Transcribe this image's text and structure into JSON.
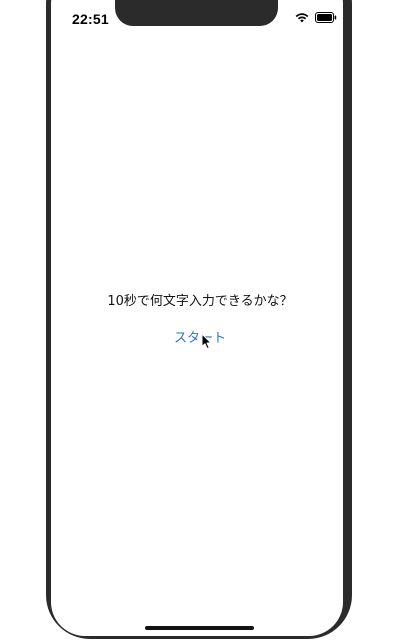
{
  "status_bar": {
    "time": "22:51",
    "wifi_icon": "wifi-icon",
    "battery_icon": "battery-icon"
  },
  "main": {
    "question": "10秒で何文字入力できるかな？",
    "start_label": "スタート"
  },
  "colors": {
    "link": "#2f6fd6",
    "frame": "#2b2b2b"
  }
}
